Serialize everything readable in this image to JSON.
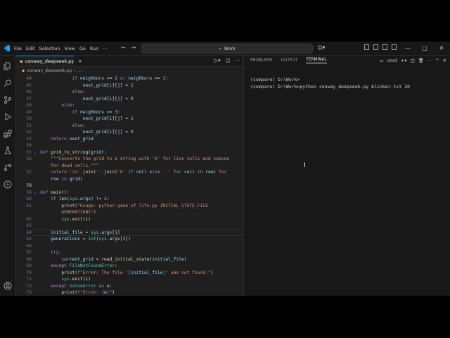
{
  "titlebar": {
    "menus": [
      "File",
      "Edit",
      "Selection",
      "View",
      "Go",
      "Run"
    ],
    "more": "···",
    "search_text": "Work",
    "controls": {
      "minimize": "—",
      "maximize": "□",
      "close": "✕"
    }
  },
  "editor": {
    "tab_label": "conway_deepseek.py",
    "breadcrumb": "conway_deepseek.py",
    "lines": [
      {
        "n": "44",
        "html": "            <span class='k'>if</span> <span class='v'>neighbors</span> <span class='p'>==</span> <span class='n'>2</span> <span class='d'>or</span> <span class='v'>neighbors</span> <span class='p'>==</span> <span class='n'>3</span><span class='p'>:</span>"
      },
      {
        "n": "45",
        "html": "                <span class='v'>next_grid</span><span class='p'>[</span><span class='v'>i</span><span class='p'>][</span><span class='v'>j</span><span class='p'>] =</span> <span class='n'>1</span>"
      },
      {
        "n": "46",
        "html": "            <span class='k'>else</span><span class='p'>:</span>"
      },
      {
        "n": "47",
        "html": "                <span class='v'>next_grid</span><span class='p'>[</span><span class='v'>i</span><span class='p'>][</span><span class='v'>j</span><span class='p'>] =</span> <span class='n'>0</span>"
      },
      {
        "n": "48",
        "html": "        <span class='k'>else</span><span class='p'>:</span>"
      },
      {
        "n": "49",
        "html": "            <span class='k'>if</span> <span class='v'>neighbors</span> <span class='p'>==</span> <span class='n'>3</span><span class='p'>:</span>"
      },
      {
        "n": "50",
        "html": "                <span class='v'>next_grid</span><span class='p'>[</span><span class='v'>i</span><span class='p'>][</span><span class='v'>j</span><span class='p'>] =</span> <span class='n'>1</span>"
      },
      {
        "n": "51",
        "html": "            <span class='k'>else</span><span class='p'>:</span>"
      },
      {
        "n": "52",
        "html": "                <span class='v'>next_grid</span><span class='p'>[</span><span class='v'>i</span><span class='p'>][</span><span class='v'>j</span><span class='p'>] =</span> <span class='n'>0</span>"
      },
      {
        "n": "53",
        "html": "    <span class='k'>return</span> <span class='v'>next_grid</span>"
      },
      {
        "n": "54",
        "html": ""
      },
      {
        "n": "55",
        "html": "<span class='d'>def</span> <span class='f'>grid_to_string</span><span class='p'>(</span><span class='v'>grid</span><span class='p'>):</span>"
      },
      {
        "n": "56",
        "html": "    <span class='s'>\"\"\"Converts the grid to a string with 'O' for live cells and spaces</span>"
      },
      {
        "n": "",
        "html": "    <span class='s'>for dead cells.\"\"\"</span>"
      },
      {
        "n": "57",
        "html": "    <span class='k'>return</span> <span class='s'>'\\n'</span><span class='p'>.</span><span class='f'>join</span><span class='p'>(</span><span class='s'>''</span><span class='p'>.</span><span class='f'>join</span><span class='p'>(</span><span class='s'>'O'</span> <span class='k'>if</span> <span class='v'>cell</span> <span class='k'>else</span> <span class='s'>' '</span> <span class='k'>for</span> <span class='v'>cell</span> <span class='k'>in</span> <span class='v'>row</span><span class='p'>)</span> <span class='k'>for</span>"
      },
      {
        "n": "",
        "html": "    <span class='v'>row</span> <span class='k'>in</span> <span class='v'>grid</span><span class='p'>)</span>"
      },
      {
        "n": "58",
        "html": ""
      },
      {
        "n": "59",
        "html": "<span class='d'>def</span> <span class='f'>main</span><span class='p'>():</span>"
      },
      {
        "n": "60",
        "html": "    <span class='k'>if</span> <span class='f'>len</span><span class='p'>(</span><span class='c'>sys</span><span class='p'>.</span><span class='v'>argv</span><span class='p'>) !=</span> <span class='n'>3</span><span class='p'>:</span>"
      },
      {
        "n": "61",
        "html": "        <span class='f'>print</span><span class='p'>(</span><span class='s'>\"Usage: python game_of_life.py INITIAL_STATE_FILE</span>"
      },
      {
        "n": "",
        "html": "        <span class='s'>GENERATIONS\"</span><span class='p'>)</span>"
      },
      {
        "n": "62",
        "html": "        <span class='c'>sys</span><span class='p'>.</span><span class='f'>exit</span><span class='p'>(</span><span class='n'>1</span><span class='p'>)</span>"
      },
      {
        "n": "63",
        "html": ""
      },
      {
        "n": "64",
        "html": "    <span class='v'>initial_file</span> <span class='p'>=</span> <span class='c'>sys</span><span class='p'>.</span><span class='v'>argv</span><span class='p'>[</span><span class='n'>1</span><span class='p'>]</span>"
      },
      {
        "n": "65",
        "html": "    <span class='v'>generations</span> <span class='p'>=</span> <span class='c'>int</span><span class='p'>(</span><span class='c'>sys</span><span class='p'>.</span><span class='v'>argv</span><span class='p'>[</span><span class='n'>2</span><span class='p'>])</span>"
      },
      {
        "n": "66",
        "html": ""
      },
      {
        "n": "67",
        "html": "    <span class='k'>try</span><span class='p'>:</span>"
      },
      {
        "n": "68",
        "html": "        <span class='v'>current_grid</span> <span class='p'>=</span> <span class='f'>read_initial_state</span><span class='p'>(</span><span class='v'>initial_file</span><span class='p'>)</span>"
      },
      {
        "n": "69",
        "html": "    <span class='k'>except</span> <span class='c'>FileNotFoundError</span><span class='p'>:</span>"
      },
      {
        "n": "70",
        "html": "        <span class='f'>print</span><span class='p'>(</span><span class='d'>f</span><span class='s'>\"Error: The file '</span><span class='d'>{</span><span class='v'>initial_file</span><span class='d'>}</span><span class='s'>' was not found.\"</span><span class='p'>)</span>"
      },
      {
        "n": "71",
        "html": "        <span class='c'>sys</span><span class='p'>.</span><span class='f'>exit</span><span class='p'>(</span><span class='n'>1</span><span class='p'>)</span>"
      },
      {
        "n": "72",
        "html": "    <span class='k'>except</span> <span class='c'>ValueError</span> <span class='k'>as</span> <span class='v'>e</span><span class='p'>:</span>"
      },
      {
        "n": "73",
        "html": "        <span class='f'>print</span><span class='p'>(</span><span class='d'>f</span><span class='s'>\"Error: </span><span class='d'>{</span><span class='v'>e</span><span class='d'>}</span><span class='s'>\"</span><span class='p'>)</span>"
      }
    ]
  },
  "panel": {
    "tabs": [
      "PROBLEMS",
      "OUTPUT",
      "TERMINAL"
    ],
    "active_tab": "TERMINAL",
    "shell": "cmd",
    "terminal_lines": [
      "(compare) D:\\Work>",
      "(compare) D:\\Work>python conway_deepseek.py blinker.txt 20"
    ]
  },
  "colors": {
    "accent": "#0078d4",
    "editor_bg": "#1f1f1f",
    "sidebar_bg": "#181818"
  }
}
